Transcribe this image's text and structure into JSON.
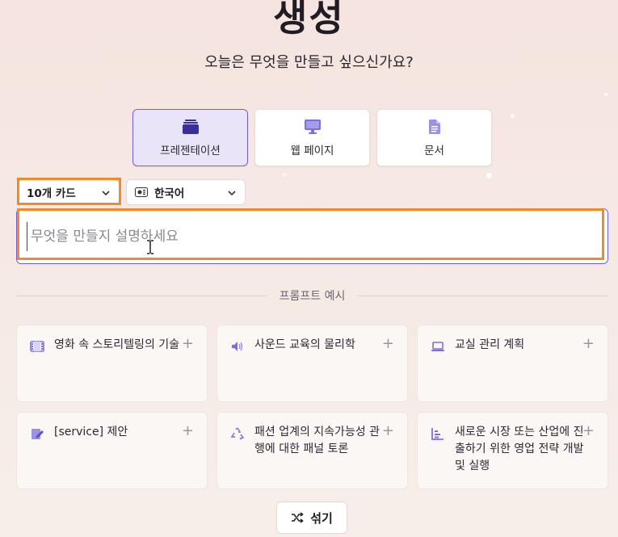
{
  "header": {
    "title": "생성",
    "subtitle": "오늘은 무엇을 만들고 싶으신가요?"
  },
  "types": [
    {
      "label": "프레젠테이션",
      "icon": "presentation-icon",
      "active": true
    },
    {
      "label": "웹 페이지",
      "icon": "monitor-icon",
      "active": false
    },
    {
      "label": "문서",
      "icon": "document-icon",
      "active": false
    }
  ],
  "options": {
    "cards": "10개 카드",
    "language": "한국어",
    "language_icon": "language-flag-icon"
  },
  "prompt": {
    "placeholder": "무엇을 만들지 설명하세요"
  },
  "examples_header": "프롬프트 예시",
  "examples": [
    {
      "text": "영화 속 스토리텔링의 기술",
      "icon": "film-icon"
    },
    {
      "text": "사운드 교육의 물리학",
      "icon": "speaker-icon"
    },
    {
      "text": "교실 관리 계획",
      "icon": "laptop-icon"
    },
    {
      "text": "[service] 제안",
      "icon": "edit-icon"
    },
    {
      "text": "패션 업계의 지속가능성 관행에 대한 패널 토론",
      "icon": "recycle-icon"
    },
    {
      "text": "새로운 시장 또는 산업에 진출하기 위한 영업 전략 개발 및 실행",
      "icon": "chart-icon"
    }
  ],
  "plus_symbol": "+",
  "shuffle_label": "섞기",
  "colors": {
    "accent": "#6f62d9",
    "highlight": "#f08a2c"
  }
}
